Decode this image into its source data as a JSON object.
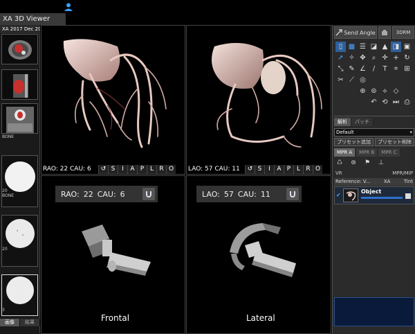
{
  "app": {
    "title": "XA 3D Viewer"
  },
  "study": {
    "date_label": "XA 2017 Dec 20"
  },
  "series_thumbs": [
    {
      "label": ""
    },
    {
      "label": ""
    },
    {
      "label": "BONE"
    },
    {
      "label": "20\nBONE"
    },
    {
      "label": "20"
    },
    {
      "label": "3"
    }
  ],
  "left_tabs": [
    "画像",
    "結果"
  ],
  "viewports": {
    "top_left": {
      "angle": "RAO: 22 CAU: 6",
      "tools": [
        "S",
        "I",
        "A",
        "P",
        "L",
        "R",
        "O"
      ]
    },
    "top_right": {
      "angle": "LAO: 57 CAU: 11",
      "tools": [
        "S",
        "I",
        "A",
        "P",
        "L",
        "R",
        "O"
      ]
    },
    "bottom_left": {
      "projection": "RAO:",
      "proj_value": "22",
      "tilt": "CAU:",
      "tilt_value": "6",
      "caption": "Frontal"
    },
    "bottom_right": {
      "projection": "LAO:",
      "proj_value": "57",
      "tilt": "CAU:",
      "tilt_value": "11",
      "caption": "Lateral"
    }
  },
  "right_panel": {
    "send_angle": "Send Angle",
    "btn_3drm": "3DRM",
    "tabs": [
      "解析",
      "パッチ"
    ],
    "preset_value": "Default",
    "preset_add": "プリセット追加",
    "preset_delete": "プリセット削除",
    "mpr_tabs": [
      "MPR A",
      "MPR B",
      "MPR C"
    ],
    "vr": "VR",
    "mpr_mip": "MPR/MIP",
    "reference": "Reference: V...",
    "xa": "XA",
    "tint": "Tint",
    "object_name": "Object"
  },
  "colors": {
    "accent": "#2f6fcf",
    "panel": "#2b2b2b"
  }
}
